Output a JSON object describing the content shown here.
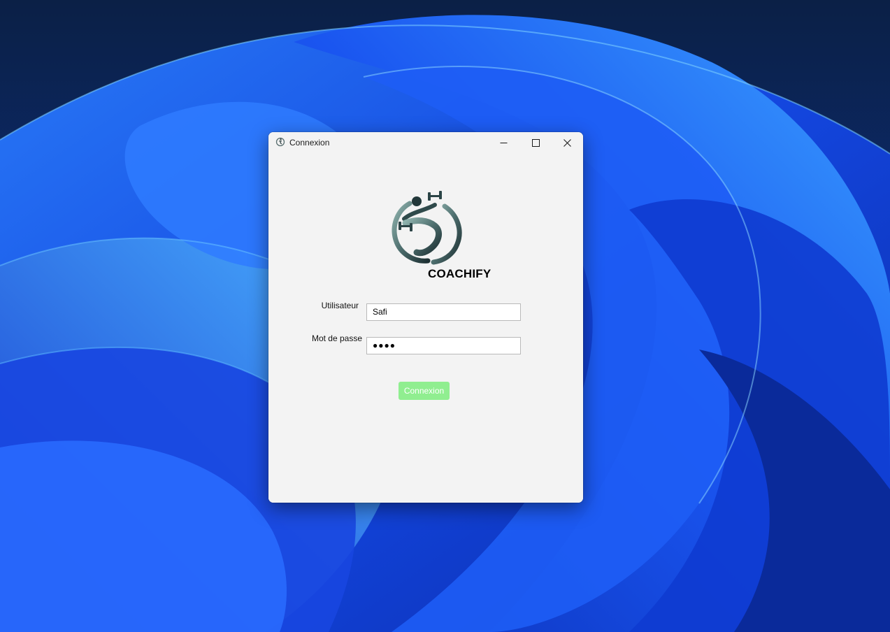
{
  "window": {
    "title": "Connexion",
    "controls": {
      "minimize_icon": "minimize-icon",
      "maximize_icon": "maximize-icon",
      "close_icon": "close-icon"
    }
  },
  "logo": {
    "brand_name": "COACHIFY",
    "icon": "fitness-runner-dumbbell-logo"
  },
  "form": {
    "username_label": "Utilisateur",
    "username_value": "Safi",
    "password_label": "Mot de passe",
    "password_masked": "●●●●",
    "submit_label": "Connexion"
  },
  "colors": {
    "button_bg": "#90ee90",
    "button_text": "#ffffff",
    "window_bg": "#f3f3f3",
    "logo_dark": "#1f3336",
    "logo_light": "#6d8f8c"
  }
}
